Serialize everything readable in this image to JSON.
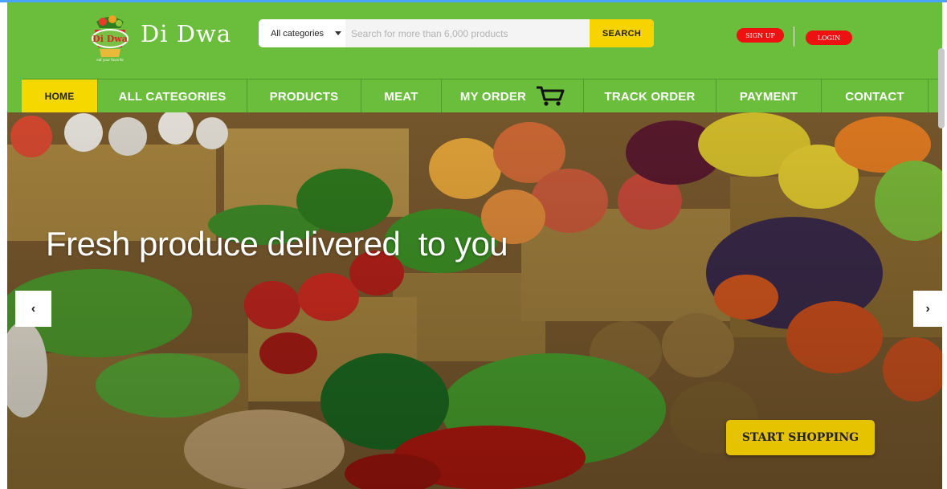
{
  "header": {
    "brand_name": "Di Dwa",
    "logo_text": "Di Dwa",
    "logo_tagline": "eat your favorite"
  },
  "search": {
    "category_label": "All categories",
    "placeholder": "Search for more than 6,000 products",
    "button_label": "SEARCH"
  },
  "auth": {
    "signup_label": "SIGN UP",
    "login_label": "LOGIN"
  },
  "nav": {
    "items": [
      {
        "label": "HOME",
        "icon": null
      },
      {
        "label": "ALL CATEGORIES",
        "icon": null
      },
      {
        "label": "PRODUCTS",
        "icon": null
      },
      {
        "label": "MEAT",
        "icon": null
      },
      {
        "label": "MY ORDER",
        "icon": "cart-icon"
      },
      {
        "label": "TRACK ORDER",
        "icon": null
      },
      {
        "label": "PAYMENT",
        "icon": null
      },
      {
        "label": "CONTACT",
        "icon": null
      }
    ]
  },
  "hero": {
    "headline": "Fresh produce delivered  to you",
    "cta_label": "START SHOPPING",
    "prev_icon": "chevron-left-icon",
    "next_icon": "chevron-right-icon",
    "prev_glyph": "‹",
    "next_glyph": "›"
  },
  "colors": {
    "brand_green": "#6bbd3c",
    "accent_yellow": "#f4d800",
    "auth_red": "#ee1111"
  }
}
